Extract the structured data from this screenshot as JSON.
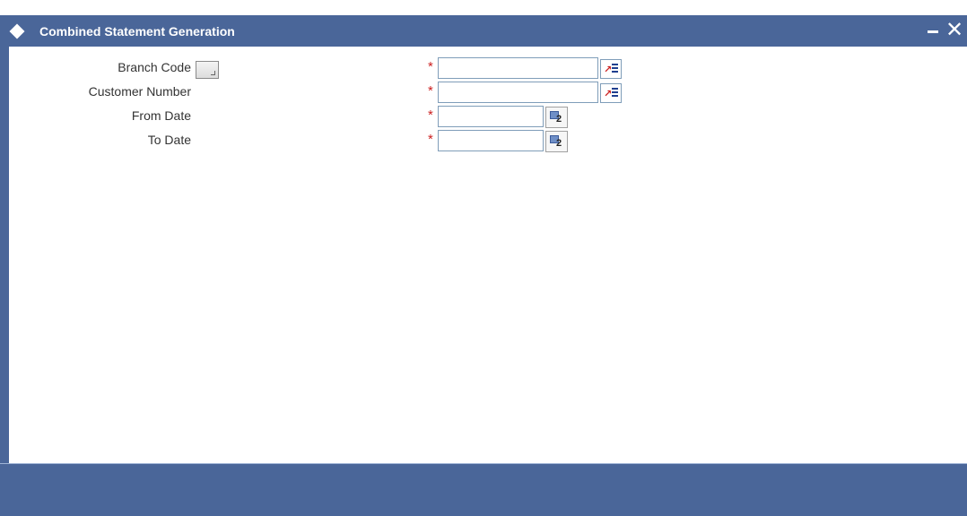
{
  "window": {
    "title": "Combined Statement Generation",
    "minimize_icon": "minimize-icon",
    "close_icon": "close-icon",
    "close_glyph": "✕",
    "colors": {
      "titlebar": "#4a6699",
      "required": "#cc2222"
    }
  },
  "form": {
    "fields": [
      {
        "label": "Branch Code",
        "required_marker": "*",
        "value": "",
        "button_icon": "list-of-values-icon"
      },
      {
        "label": "Customer Number",
        "required_marker": "*",
        "value": "",
        "button_icon": "list-of-values-icon"
      },
      {
        "label": "From Date",
        "required_marker": "*",
        "value": "",
        "button_icon": "calendar-icon",
        "calendar_digit": "2"
      },
      {
        "label": "To Date",
        "required_marker": "*",
        "value": "",
        "button_icon": "calendar-icon",
        "calendar_digit": "2"
      }
    ]
  }
}
